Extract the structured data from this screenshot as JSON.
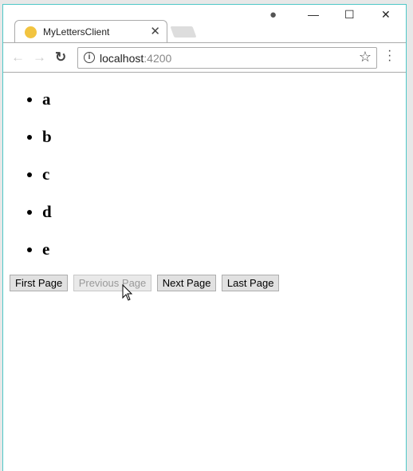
{
  "browser": {
    "tab_title": "MyLettersClient",
    "url_host": "localhost",
    "url_port": ":4200"
  },
  "letters": [
    "a",
    "b",
    "c",
    "d",
    "e"
  ],
  "pagination": {
    "first": "First Page",
    "previous": "Previous Page",
    "next": "Next Page",
    "last": "Last Page",
    "previous_disabled": true
  }
}
